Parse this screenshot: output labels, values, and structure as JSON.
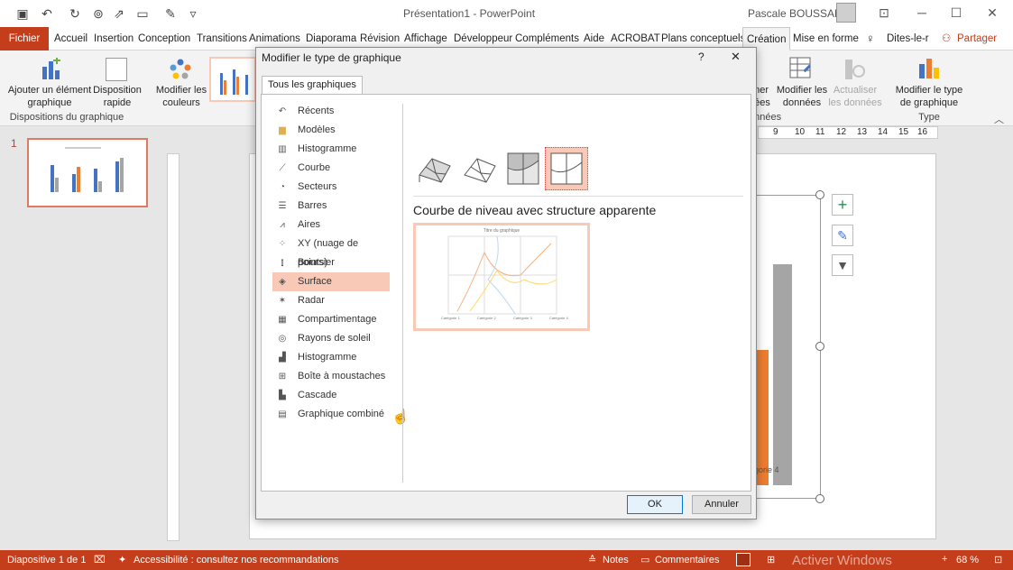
{
  "window": {
    "title": "Présentation1  -  PowerPoint",
    "user": "Pascale BOUSSARD"
  },
  "tabs": [
    "Fichier",
    "Accueil",
    "Insertion",
    "Conception",
    "Transitions",
    "Animations",
    "Diaporama",
    "Révision",
    "Affichage",
    "Développeur",
    "Compléments",
    "Aide",
    "ACROBAT",
    "Plans conceptuels",
    "Création",
    "Mise en forme"
  ],
  "tell_me": "Dites-le-r",
  "share": "Partager",
  "ribbon": {
    "add_element": "Ajouter un élément",
    "add_element2": "graphique",
    "quick_layout": "Disposition",
    "quick_layout2": "rapide",
    "change_colors": "Modifier les",
    "change_colors2": "couleurs",
    "group_layouts": "Dispositions du graphique",
    "select_data": "nner",
    "select_data2": "nées",
    "edit_data": "Modifier les",
    "edit_data2": "données",
    "refresh_data": "Actualiser",
    "refresh_data2": "les données",
    "group_data": "onnées",
    "change_type": "Modifier le type",
    "change_type2": "de graphique",
    "group_type": "Type"
  },
  "slide_number": "1",
  "ruler_marks": [
    "9",
    "10",
    "11",
    "12",
    "13",
    "14",
    "15",
    "16"
  ],
  "slide_chart": {
    "category_label": "gorie 4"
  },
  "dialog": {
    "title": "Modifier le type de graphique",
    "help": "?",
    "close": "✕",
    "tab": "Tous les graphiques",
    "categories": [
      "Récents",
      "Modèles",
      "Histogramme",
      "Courbe",
      "Secteurs",
      "Barres",
      "Aires",
      "XY (nuage de points)",
      "Boursier",
      "Surface",
      "Radar",
      "Compartimentage",
      "Rayons de soleil",
      "Histogramme",
      "Boîte à moustaches",
      "Cascade",
      "Graphique combiné"
    ],
    "selected_category": "Surface",
    "subtype_heading": "Courbe de niveau avec structure apparente",
    "preview": {
      "title": "Titre du graphique",
      "categories": [
        "Catégorie 1",
        "Catégorie 2",
        "Catégorie 3",
        "Catégorie 4"
      ]
    },
    "ok": "OK",
    "cancel": "Annuler"
  },
  "status": {
    "slide": "Diapositive 1 de 1",
    "accessibility": "Accessibilité : consultez nos recommandations",
    "notes": "Notes",
    "comments": "Commentaires",
    "zoom": "68 %",
    "watermark": "Activer Windows"
  },
  "colors": {
    "accent": "#c43e1c",
    "selected_category": "#f8c9b7",
    "bar_orange": "#ed7d31",
    "bar_grey": "#a5a5a5",
    "bar_blue": "#4472c4"
  }
}
